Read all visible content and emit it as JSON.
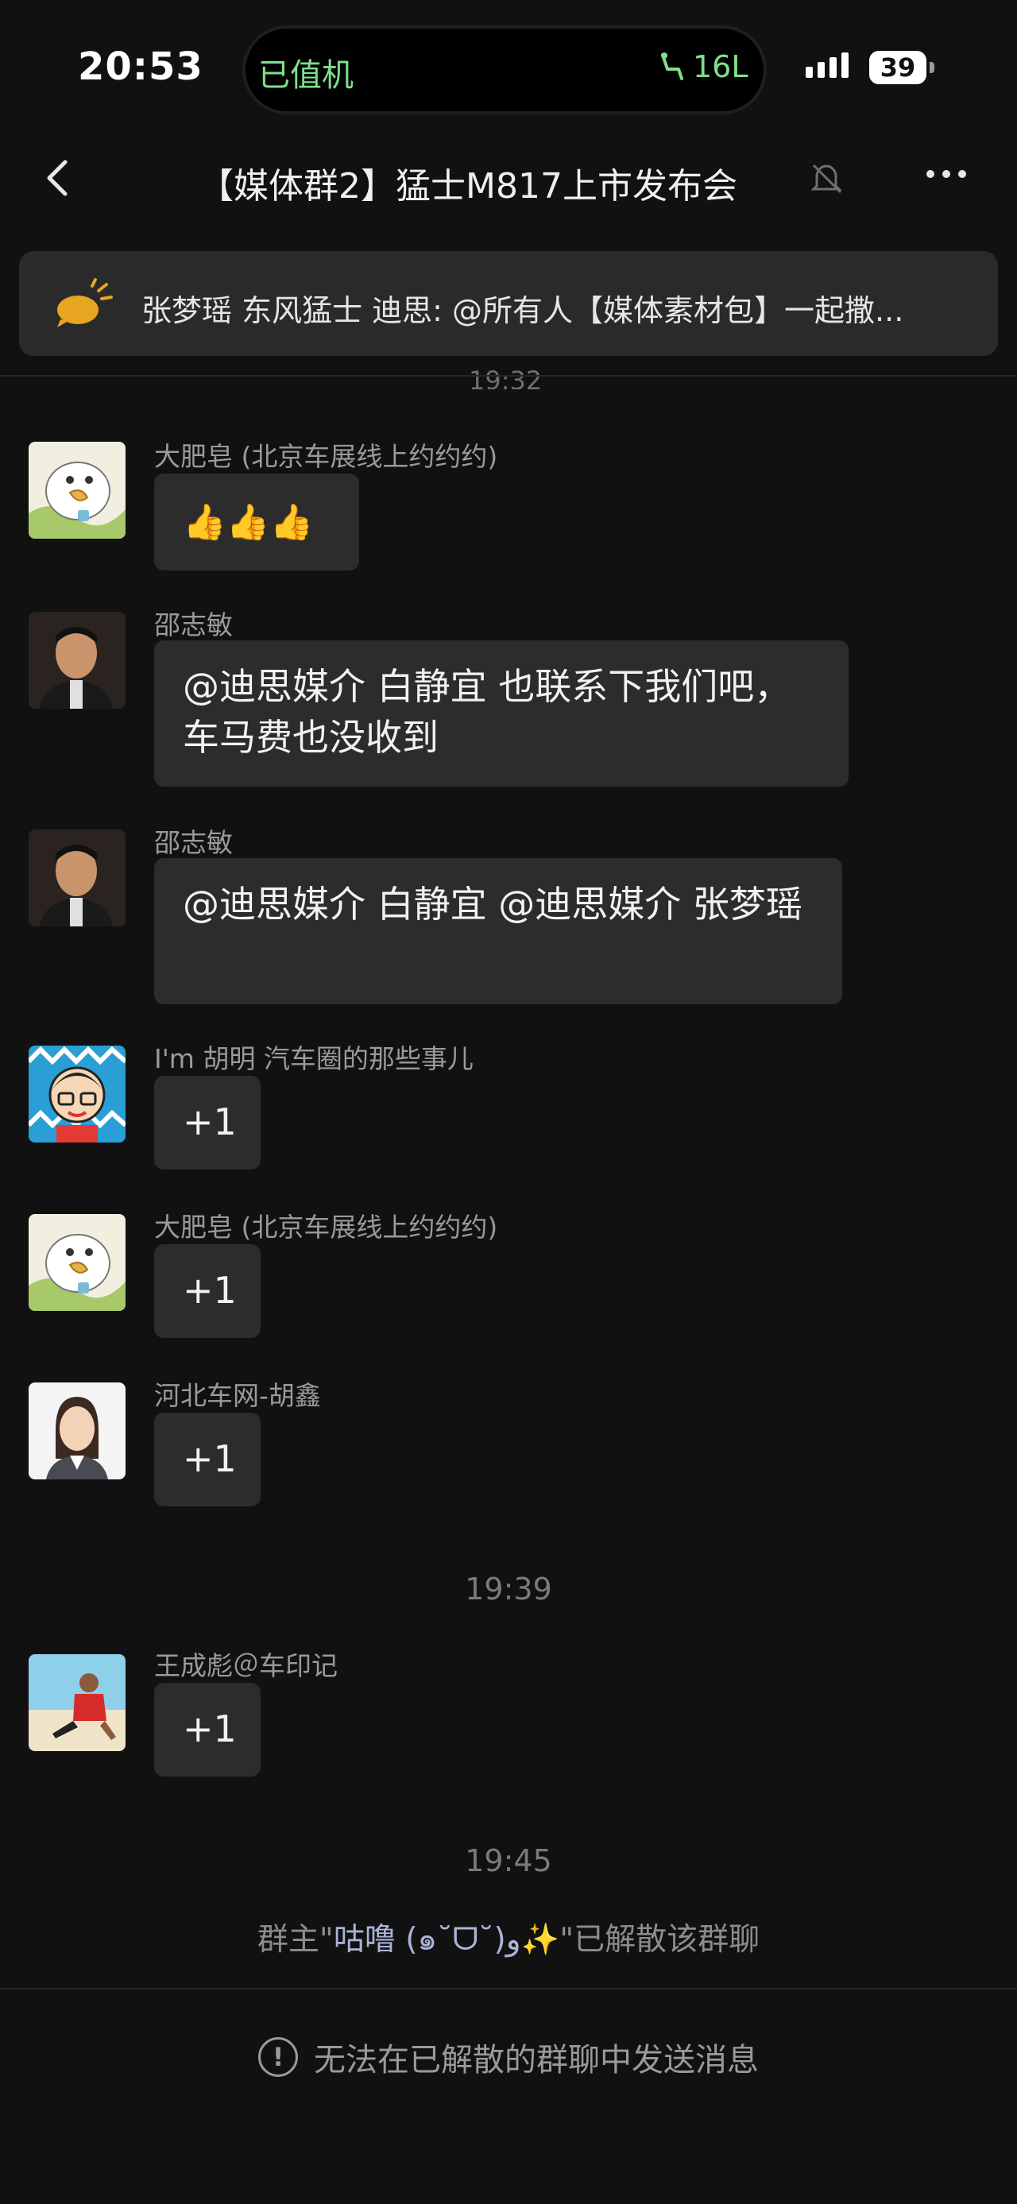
{
  "status_bar": {
    "time": "20:53",
    "island_left": "已值机",
    "island_right": "16L",
    "battery": "39",
    "accent": "#7fe08a"
  },
  "header": {
    "back_icon": "chevron-left-icon",
    "title": "【媒体群2】猛士M817上市发布会",
    "mute_icon": "bell-off-icon",
    "more_icon": "more-icon"
  },
  "notice": {
    "icon": "megaphone-icon",
    "text": "张梦瑶 东风猛士 迪思: @所有人【媒体素材包】一起撒..."
  },
  "cut_timestamp": "19:32",
  "messages": [
    {
      "sender": "大肥皂 (北京车展线上约约约)",
      "text": "👍👍👍",
      "avatar": "duck"
    },
    {
      "sender": "邵志敏",
      "text": "@迪思媒介 白静宜 也联系下我们吧，车马费也没收到",
      "avatar": "man"
    },
    {
      "sender": "邵志敏",
      "text": "@迪思媒介 白静宜 @迪思媒介 张梦瑶",
      "avatar": "man"
    },
    {
      "sender": "I'm 胡明   汽车圈的那些事儿",
      "text": "+1",
      "avatar": "cartoon"
    },
    {
      "sender": "大肥皂 (北京车展线上约约约)",
      "text": "+1",
      "avatar": "duck"
    },
    {
      "sender": "河北车网-胡鑫",
      "text": "+1",
      "avatar": "woman"
    },
    {
      "sender": "王成彪＠车印记",
      "text": "+1",
      "avatar": "beach"
    }
  ],
  "timestamps": [
    "19:39",
    "19:45"
  ],
  "system_message": {
    "prefix": "群主\"",
    "name": "咕噜 (๑˘ᗜ˘)و✨",
    "suffix": "\"已解散该群聊"
  },
  "footer": {
    "icon": "warning-icon",
    "text": "无法在已解散的群聊中发送消息"
  }
}
